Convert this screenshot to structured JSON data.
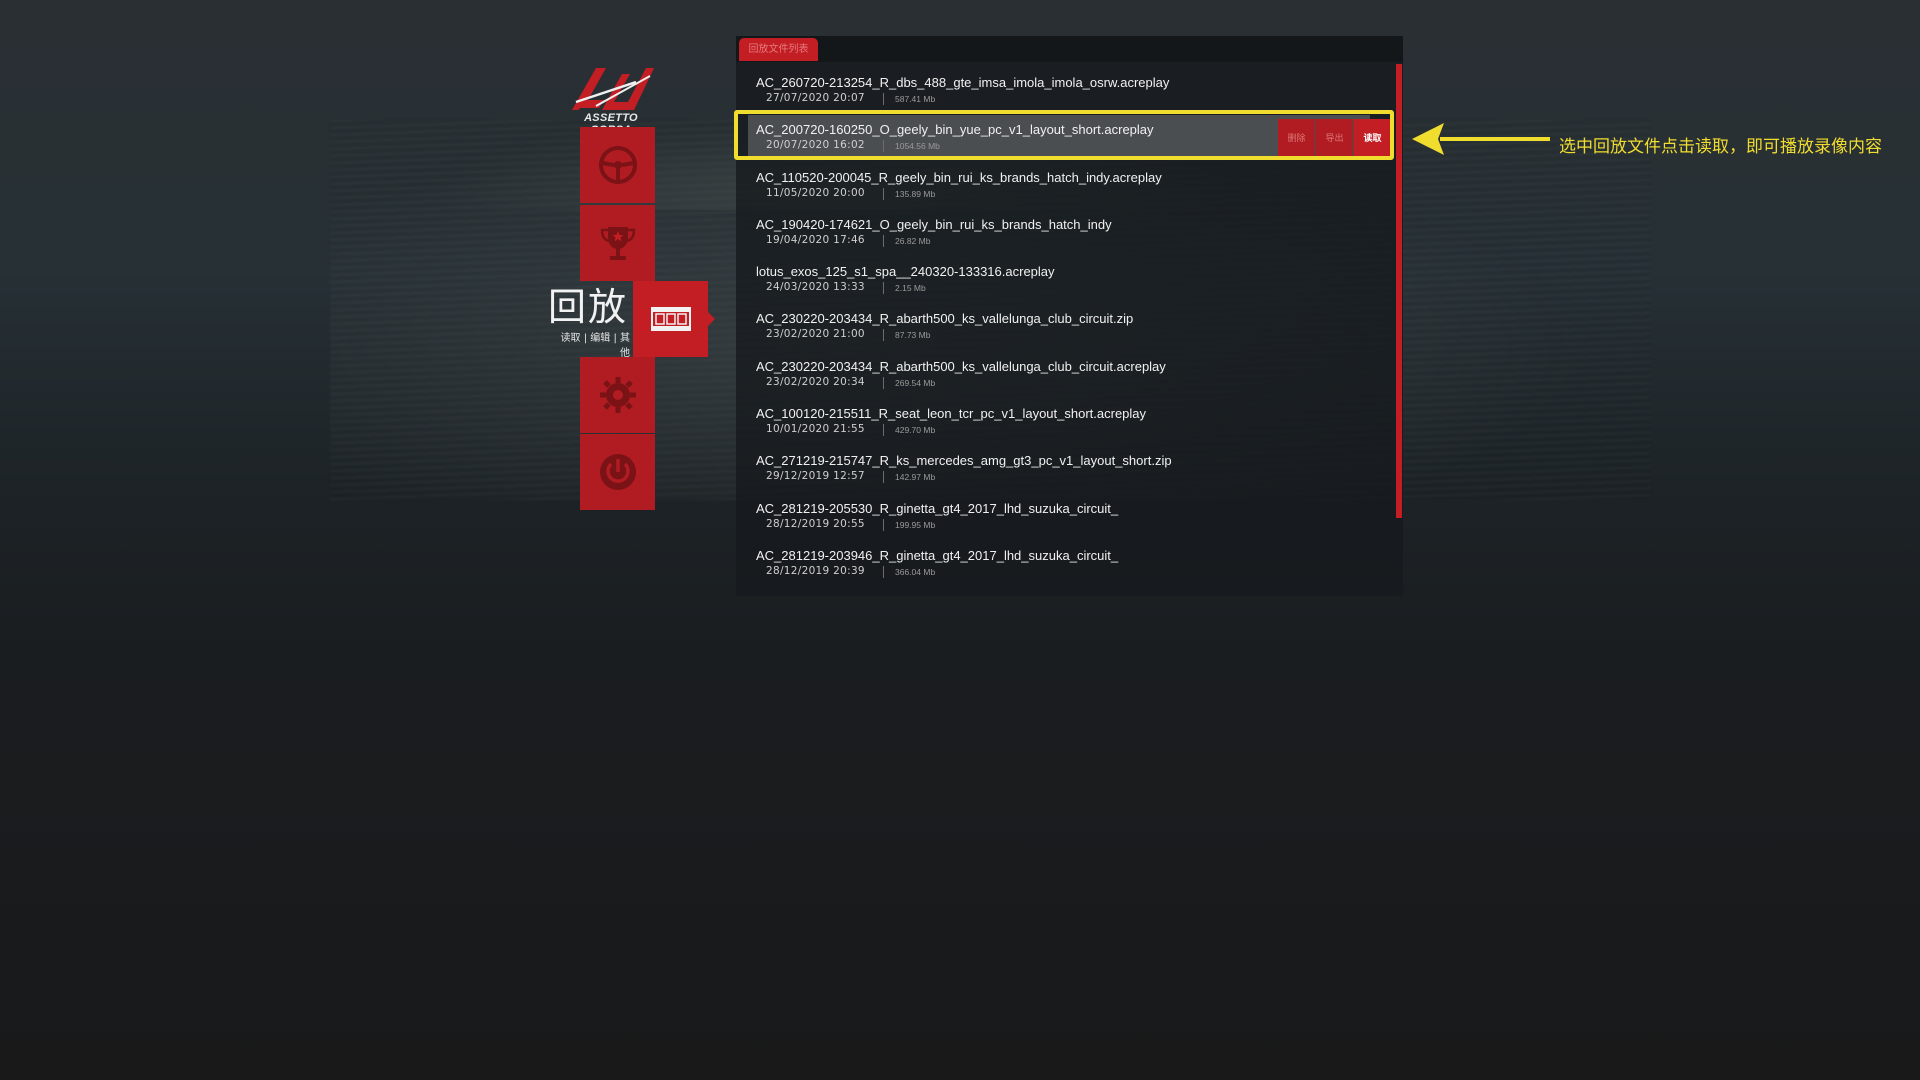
{
  "app": {
    "logo_text": "ASSETTO CORSA"
  },
  "nav": {
    "section_title": "回放",
    "section_subtitle": "读取 | 编辑 | 其他",
    "items": [
      {
        "name": "drive",
        "icon": "steering-wheel-icon"
      },
      {
        "name": "events",
        "icon": "trophy-icon"
      },
      {
        "name": "replays",
        "icon": "film-icon",
        "active": true
      },
      {
        "name": "settings",
        "icon": "gear-icon"
      },
      {
        "name": "exit",
        "icon": "power-icon"
      }
    ]
  },
  "panel": {
    "tab_label": "回放文件列表",
    "rows": [
      {
        "name": "AC_260720-213254_R_dbs_488_gte_imsa_imola_imola_osrw.acreplay",
        "date": "27/07/2020 20:07",
        "size": "587.41 Mb"
      },
      {
        "name": "AC_200720-160250_O_geely_bin_yue_pc_v1_layout_short.acreplay",
        "date": "20/07/2020 16:02",
        "size": "1054.56 Mb",
        "selected": true
      },
      {
        "name": "AC_110520-200045_R_geely_bin_rui_ks_brands_hatch_indy.acreplay",
        "date": "11/05/2020 20:00",
        "size": "135.89 Mb"
      },
      {
        "name": "AC_190420-174621_O_geely_bin_rui_ks_brands_hatch_indy",
        "date": "19/04/2020 17:46",
        "size": "26.82 Mb"
      },
      {
        "name": "lotus_exos_125_s1_spa__240320-133316.acreplay",
        "date": "24/03/2020 13:33",
        "size": "2.15 Mb"
      },
      {
        "name": "AC_230220-203434_R_abarth500_ks_vallelunga_club_circuit.zip",
        "date": "23/02/2020 21:00",
        "size": "87.73 Mb"
      },
      {
        "name": "AC_230220-203434_R_abarth500_ks_vallelunga_club_circuit.acreplay",
        "date": "23/02/2020 20:34",
        "size": "269.54 Mb"
      },
      {
        "name": "AC_100120-215511_R_seat_leon_tcr_pc_v1_layout_short.acreplay",
        "date": "10/01/2020 21:55",
        "size": "429.70 Mb"
      },
      {
        "name": "AC_271219-215747_R_ks_mercedes_amg_gt3_pc_v1_layout_short.zip",
        "date": "29/12/2019 12:57",
        "size": "142.97 Mb"
      },
      {
        "name": "AC_281219-205530_R_ginetta_gt4_2017_lhd_suzuka_circuit_",
        "date": "28/12/2019 20:55",
        "size": "199.95 Mb"
      },
      {
        "name": "AC_281219-203946_R_ginetta_gt4_2017_lhd_suzuka_circuit_",
        "date": "28/12/2019 20:39",
        "size": "366.04 Mb"
      }
    ],
    "row_actions": {
      "delete_label": "删除",
      "share_label": "导出",
      "load_label": "读取"
    }
  },
  "annotation": {
    "text": "选中回放文件点击读取，即可播放录像内容",
    "color": "#f1dd2e"
  },
  "colors": {
    "accent_red": "#c41e25",
    "highlight_yellow": "#f1dd2e"
  }
}
